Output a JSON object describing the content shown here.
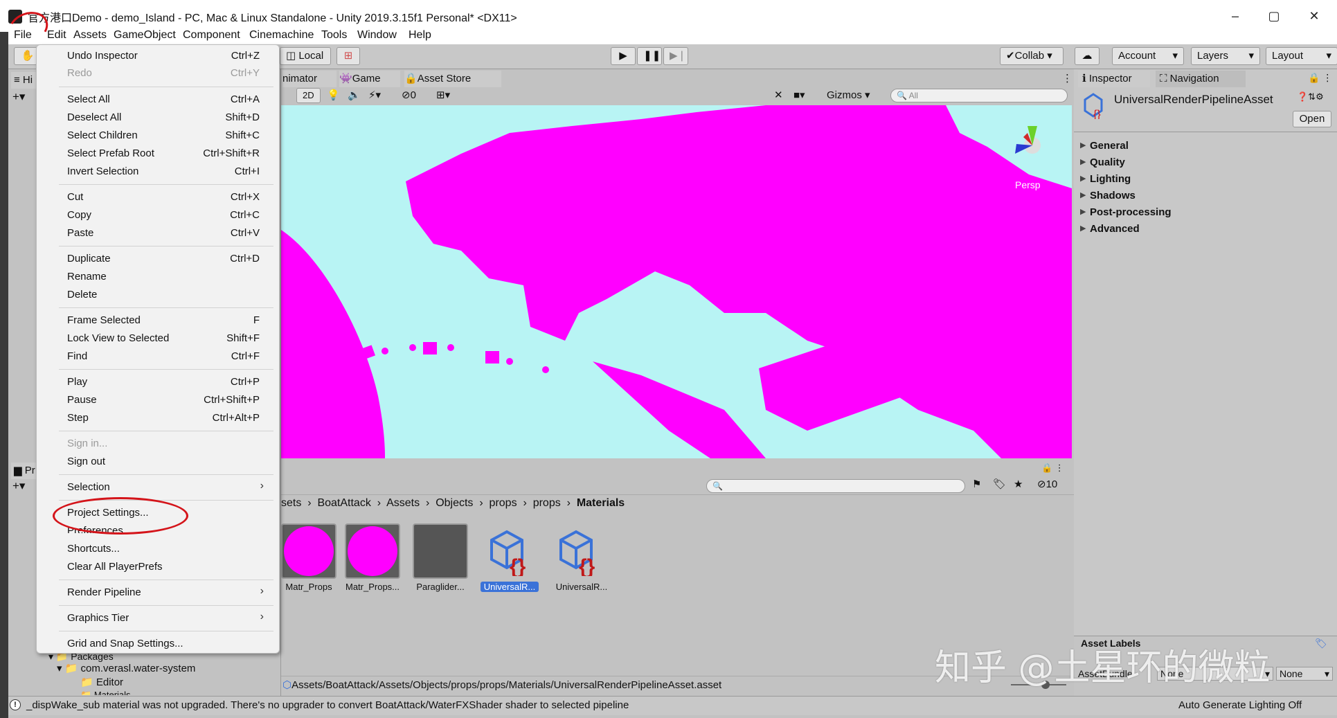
{
  "window": {
    "title": "官方港口Demo - demo_Island - PC, Mac & Linux Standalone - Unity 2019.3.15f1 Personal* <DX11>",
    "controls": [
      "–",
      "▢",
      "✕"
    ]
  },
  "menubar": [
    "File",
    "Edit",
    "Assets",
    "GameObject",
    "Component",
    "Cinemachine",
    "Tools",
    "Window",
    "Help"
  ],
  "toolbar": {
    "local_label": "Local",
    "collab_label": "Collab",
    "account_label": "Account",
    "layers_label": "Layers",
    "layout_label": "Layout"
  },
  "file_menu": {
    "items": [
      {
        "label": "Undo Inspector",
        "shortcut": "Ctrl+Z"
      },
      {
        "label": "Redo",
        "shortcut": "Ctrl+Y",
        "disabled": true
      },
      {
        "label": "Select All",
        "shortcut": "Ctrl+A"
      },
      {
        "label": "Deselect All",
        "shortcut": "Shift+D"
      },
      {
        "label": "Select Children",
        "shortcut": "Shift+C"
      },
      {
        "label": "Select Prefab Root",
        "shortcut": "Ctrl+Shift+R"
      },
      {
        "label": "Invert Selection",
        "shortcut": "Ctrl+I"
      },
      {
        "label": "Cut",
        "shortcut": "Ctrl+X"
      },
      {
        "label": "Copy",
        "shortcut": "Ctrl+C"
      },
      {
        "label": "Paste",
        "shortcut": "Ctrl+V"
      },
      {
        "label": "Duplicate",
        "shortcut": "Ctrl+D"
      },
      {
        "label": "Rename",
        "shortcut": ""
      },
      {
        "label": "Delete",
        "shortcut": ""
      },
      {
        "label": "Frame Selected",
        "shortcut": "F"
      },
      {
        "label": "Lock View to Selected",
        "shortcut": "Shift+F"
      },
      {
        "label": "Find",
        "shortcut": "Ctrl+F"
      },
      {
        "label": "Play",
        "shortcut": "Ctrl+P"
      },
      {
        "label": "Pause",
        "shortcut": "Ctrl+Shift+P"
      },
      {
        "label": "Step",
        "shortcut": "Ctrl+Alt+P"
      },
      {
        "label": "Sign in...",
        "shortcut": "",
        "disabled": true
      },
      {
        "label": "Sign out",
        "shortcut": ""
      },
      {
        "label": "Selection",
        "shortcut": ""
      },
      {
        "label": "Project Settings...",
        "shortcut": ""
      },
      {
        "label": "Preferences...",
        "shortcut": ""
      },
      {
        "label": "Shortcuts...",
        "shortcut": ""
      },
      {
        "label": "Clear All PlayerPrefs",
        "shortcut": ""
      },
      {
        "label": "Render Pipeline",
        "shortcut": ""
      },
      {
        "label": "Graphics Tier",
        "shortcut": ""
      },
      {
        "label": "Grid and Snap Settings...",
        "shortcut": ""
      }
    ]
  },
  "scene_tabs": {
    "animator": "nimator",
    "game": "Game",
    "asset_store": "Asset Store"
  },
  "scene_toolbar": {
    "mode_2d": "2D",
    "hidden_count": "0",
    "gizmos": "Gizmos",
    "search_placeholder": "All",
    "persp": "Persp"
  },
  "inspector": {
    "tab_inspector": "Inspector",
    "tab_navigation": "Navigation",
    "asset_name": "UniversalRenderPipelineAsset",
    "open_button": "Open",
    "sections": [
      "General",
      "Quality",
      "Lighting",
      "Shadows",
      "Post-processing",
      "Advanced"
    ],
    "asset_labels": "Asset Labels",
    "assetbundle_label": "AssetBundle",
    "assetbundle_value": "None",
    "variant_value": "None"
  },
  "project": {
    "breadcrumb": [
      "sets",
      "BoatAttack",
      "Assets",
      "Objects",
      "props",
      "props",
      "Materials"
    ],
    "assets": [
      {
        "label": "Matr_Props",
        "kind": "magenta"
      },
      {
        "label": "Matr_Props...",
        "kind": "magenta"
      },
      {
        "label": "Paraglider...",
        "kind": "gray"
      },
      {
        "label": "UniversalR...",
        "kind": "asset",
        "selected": true
      },
      {
        "label": "UniversalR...",
        "kind": "asset"
      }
    ],
    "count": "10",
    "path": "Assets/BoatAttack/Assets/Objects/props/props/Materials/UniversalRenderPipelineAsset.asset",
    "tree": [
      "Packages",
      "com.verasl.water-system",
      "Editor",
      "Materials"
    ]
  },
  "left_tabs": {
    "hierarchy": "Hi",
    "project": "Pr"
  },
  "status": {
    "message": "_dispWake_sub material was not upgraded. There's no upgrader to convert BoatAttack/WaterFXShader shader to selected pipeline",
    "right": "Auto Generate Lighting Off"
  },
  "watermark": "知乎 @土星环的微粒",
  "colors": {
    "magenta": "#ff00ff",
    "sky": "#b8f4f4",
    "annotation_red": "#d4141a",
    "selection_blue": "#3a72d8"
  }
}
